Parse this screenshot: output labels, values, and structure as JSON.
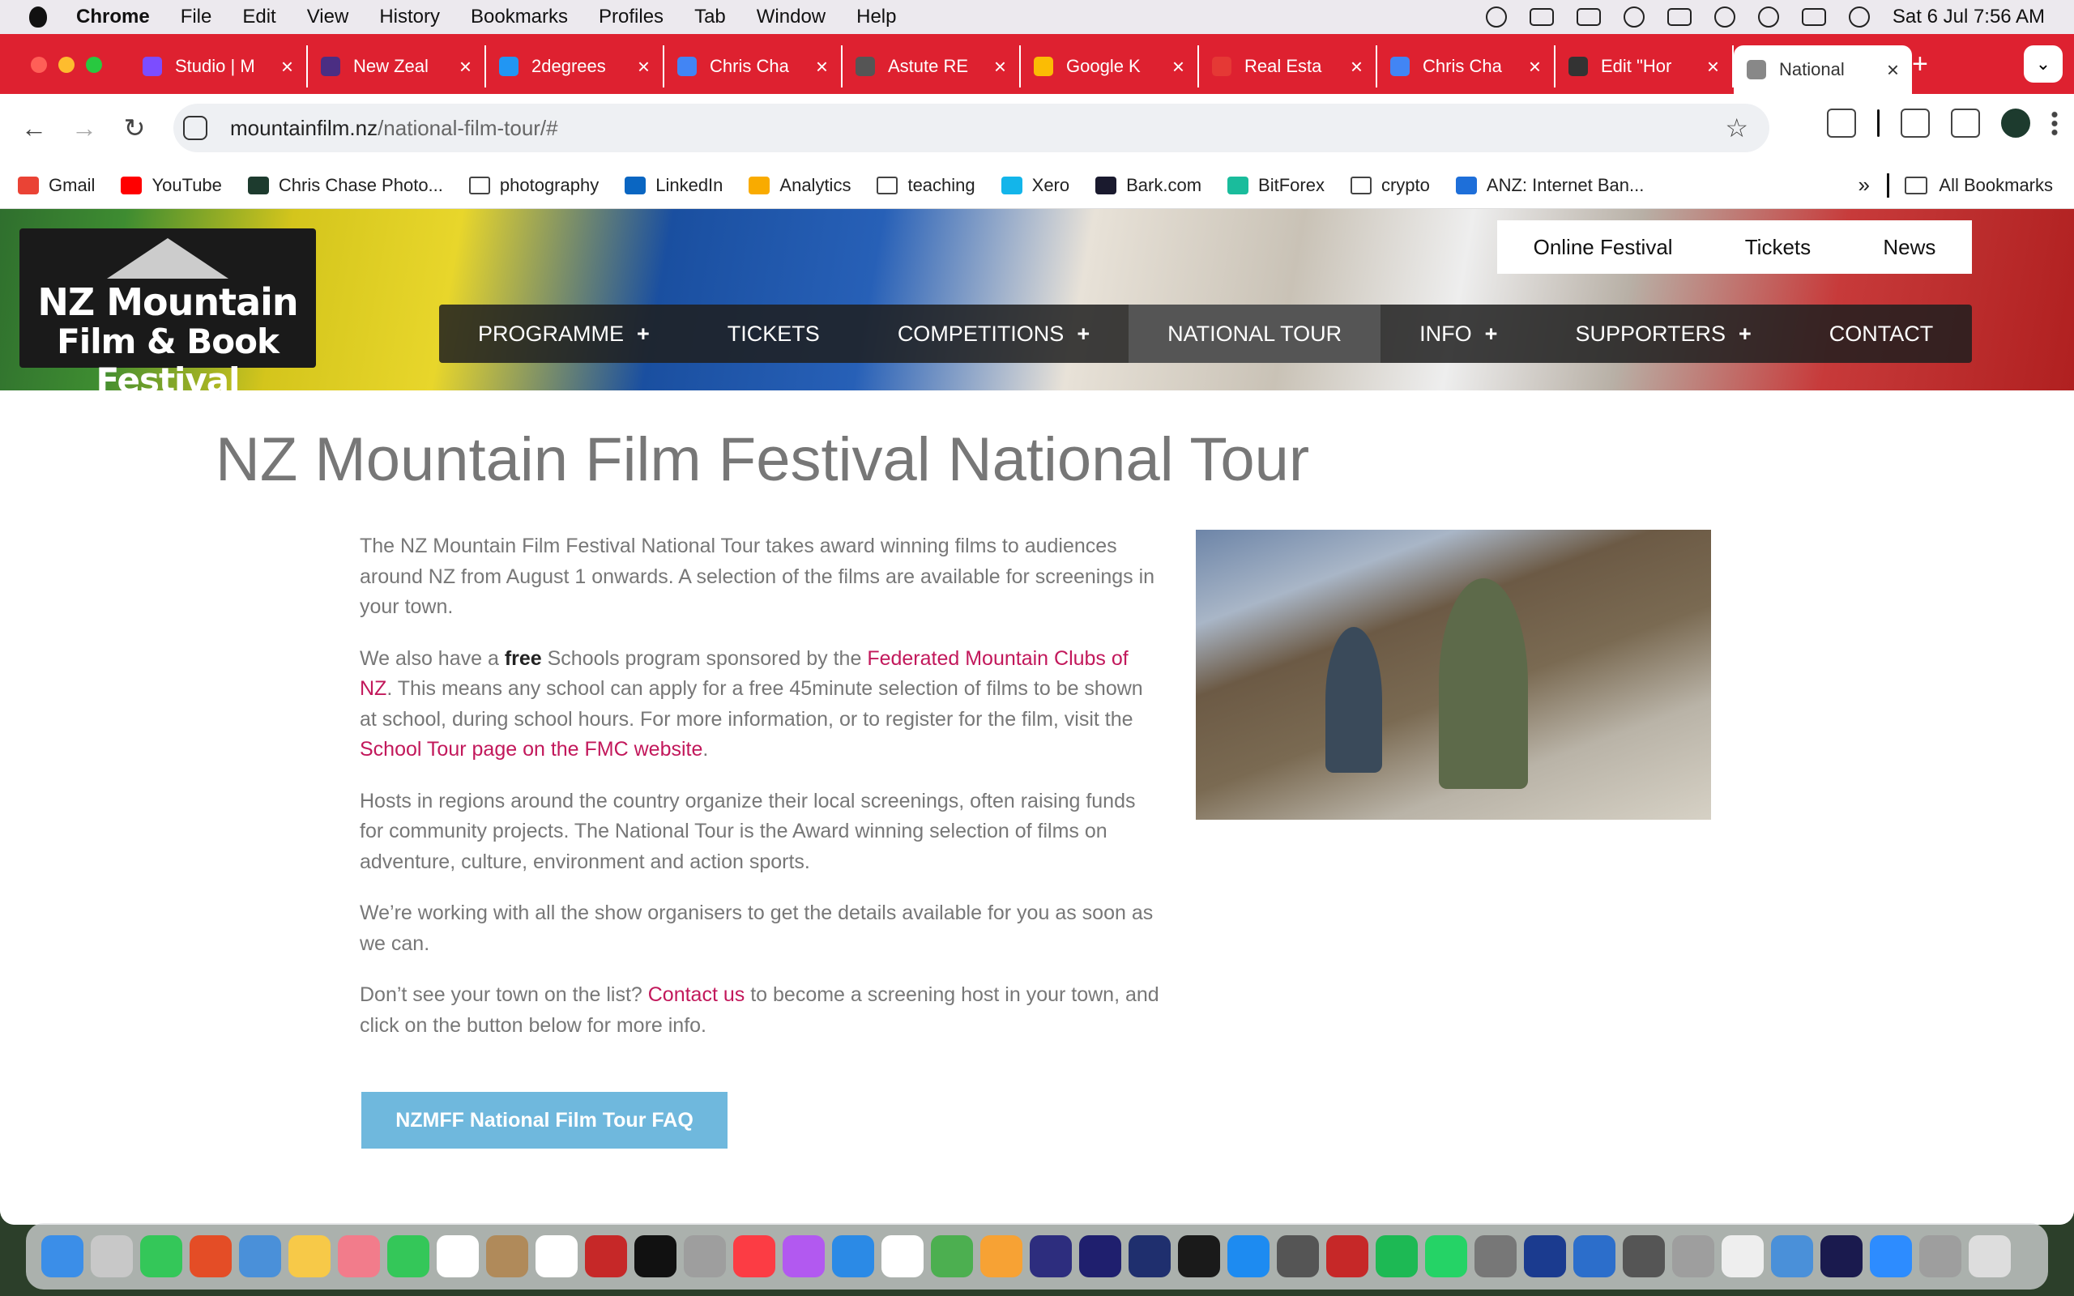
{
  "menubar": {
    "app": "Chrome",
    "items": [
      "File",
      "Edit",
      "View",
      "History",
      "Bookmarks",
      "Profiles",
      "Tab",
      "Window",
      "Help"
    ],
    "datetime": "Sat 6 Jul  7:56 AM"
  },
  "tabs": [
    {
      "label": "Studio | M",
      "favicon_color": "#7c4dff"
    },
    {
      "label": "New Zeal",
      "favicon_color": "#4b2e83"
    },
    {
      "label": "2degrees",
      "favicon_color": "#2196f3"
    },
    {
      "label": "Chris Cha",
      "favicon_color": "#4285f4"
    },
    {
      "label": "Astute RE",
      "favicon_color": "#555555"
    },
    {
      "label": "Google K",
      "favicon_color": "#fbbc04"
    },
    {
      "label": "Real Esta",
      "favicon_color": "#e53935"
    },
    {
      "label": "Chris Cha",
      "favicon_color": "#4285f4"
    },
    {
      "label": "Edit \"Hor",
      "favicon_color": "#333333"
    },
    {
      "label": "National",
      "favicon_color": "#888888",
      "active": true
    }
  ],
  "toolbar": {
    "url_host": "mountainfilm.nz",
    "url_path": "/national-film-tour/#"
  },
  "bookmarks": [
    {
      "label": "Gmail",
      "color": "#ea4335"
    },
    {
      "label": "YouTube",
      "color": "#ff0000"
    },
    {
      "label": "Chris Chase Photo...",
      "color": "#1d3b2e"
    },
    {
      "label": "photography",
      "folder": true
    },
    {
      "label": "LinkedIn",
      "color": "#0a66c2"
    },
    {
      "label": "Analytics",
      "color": "#f9ab00"
    },
    {
      "label": "teaching",
      "folder": true
    },
    {
      "label": "Xero",
      "color": "#13b5ea"
    },
    {
      "label": "Bark.com",
      "color": "#1a1a2e"
    },
    {
      "label": "BitForex",
      "color": "#1abc9c"
    },
    {
      "label": "crypto",
      "folder": true
    },
    {
      "label": "ANZ: Internet Ban...",
      "color": "#1e6fd9"
    }
  ],
  "bookmarks_all": "All Bookmarks",
  "site": {
    "logo_line1": "NZ Mountain",
    "logo_line2": "Film & Book Festival",
    "topnav": [
      "Online Festival",
      "Tickets",
      "News"
    ],
    "mainnav": [
      {
        "label": "PROGRAMME",
        "plus": "+"
      },
      {
        "label": "TICKETS",
        "plus": ""
      },
      {
        "label": "COMPETITIONS",
        "plus": "+"
      },
      {
        "label": "NATIONAL TOUR",
        "plus": "",
        "active": true
      },
      {
        "label": "INFO",
        "plus": "+"
      },
      {
        "label": "SUPPORTERS",
        "plus": "+"
      },
      {
        "label": "CONTACT",
        "plus": ""
      }
    ]
  },
  "content": {
    "title": "NZ Mountain Film Festival National Tour",
    "p1": "The NZ Mountain Film Festival National Tour takes award winning films to audiences around NZ from August 1 onwards. A selection of the films are available for screenings in your town.",
    "p2_a": "We also have a ",
    "p2_b": "free",
    "p2_c": " Schools program sponsored by the ",
    "p2_link1": "Federated Mountain Clubs of NZ",
    "p2_d": ". This means any school can apply for a free 45minute selection of films to be shown at school, during school hours.  For more information, or to register for the film, visit the ",
    "p2_link2": "School Tour page on the FMC website",
    "p2_e": ".",
    "p3": "Hosts in regions around the country organize their local screenings, often raising funds for community projects.  The National Tour is the Award winning selection of films on adventure, culture, environment and action sports.",
    "p4": "We’re working with all the show organisers to get the details available for you as soon as we can.",
    "p5_a": "Don’t see your town on the list? ",
    "p5_link": "Contact us",
    "p5_b": " to become a screening host in your town, and click on the button below for more info.",
    "faq_button": "NZMFF National Film Tour FAQ"
  },
  "dock_colors": [
    "#3b8ee8",
    "#c8c8c8",
    "#34c759",
    "#e44d26",
    "#4a90d9",
    "#f7c948",
    "#f27c8b",
    "#34c759",
    "#ffffff",
    "#b08a5a",
    "#ffffff",
    "#c62828",
    "#111111",
    "#9e9e9e",
    "#fc3c44",
    "#b259f0",
    "#2b8ae6",
    "#ffffff",
    "#4caf50",
    "#f7a234",
    "#2d2d7e",
    "#1f1f6e",
    "#1f2f6e",
    "#1a1a1a",
    "#1d8bf1",
    "#555555",
    "#c62828",
    "#1db954",
    "#25d366",
    "#777777",
    "#1b3b8f",
    "#2c6ecb",
    "#555555",
    "#9e9e9e",
    "#eeeeee",
    "#4a90d9",
    "#1a1a4e",
    "#2d8cff",
    "#9e9e9e",
    "#dddddd"
  ]
}
